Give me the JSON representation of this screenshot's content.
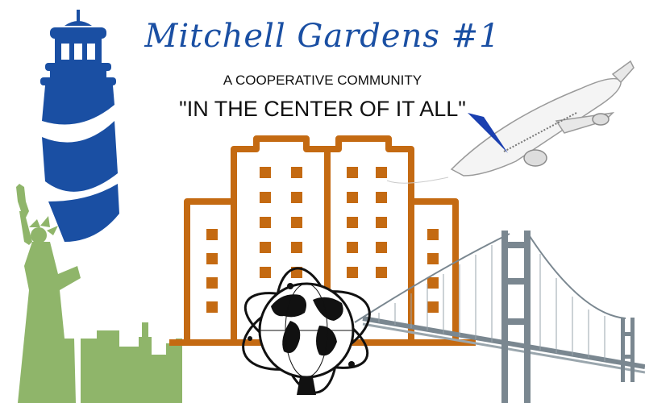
{
  "header": {
    "title": "Mitchell Gardens #1",
    "subtitle": "A COOPERATIVE COMMUNITY",
    "tagline": "\"IN THE CENTER OF IT ALL\""
  },
  "colors": {
    "title_blue": "#1a4fa3",
    "lighthouse_blue": "#1a4fa3",
    "building_orange": "#c46a12",
    "liberty_green": "#8fb56a",
    "bridge_gray": "#7a8790",
    "text_black": "#111111"
  },
  "icons": [
    "lighthouse-icon",
    "statue-of-liberty-icon",
    "city-skyline-icon",
    "apartment-buildings-icon",
    "airplane-icon",
    "unisphere-globe-icon",
    "suspension-bridge-icon"
  ]
}
